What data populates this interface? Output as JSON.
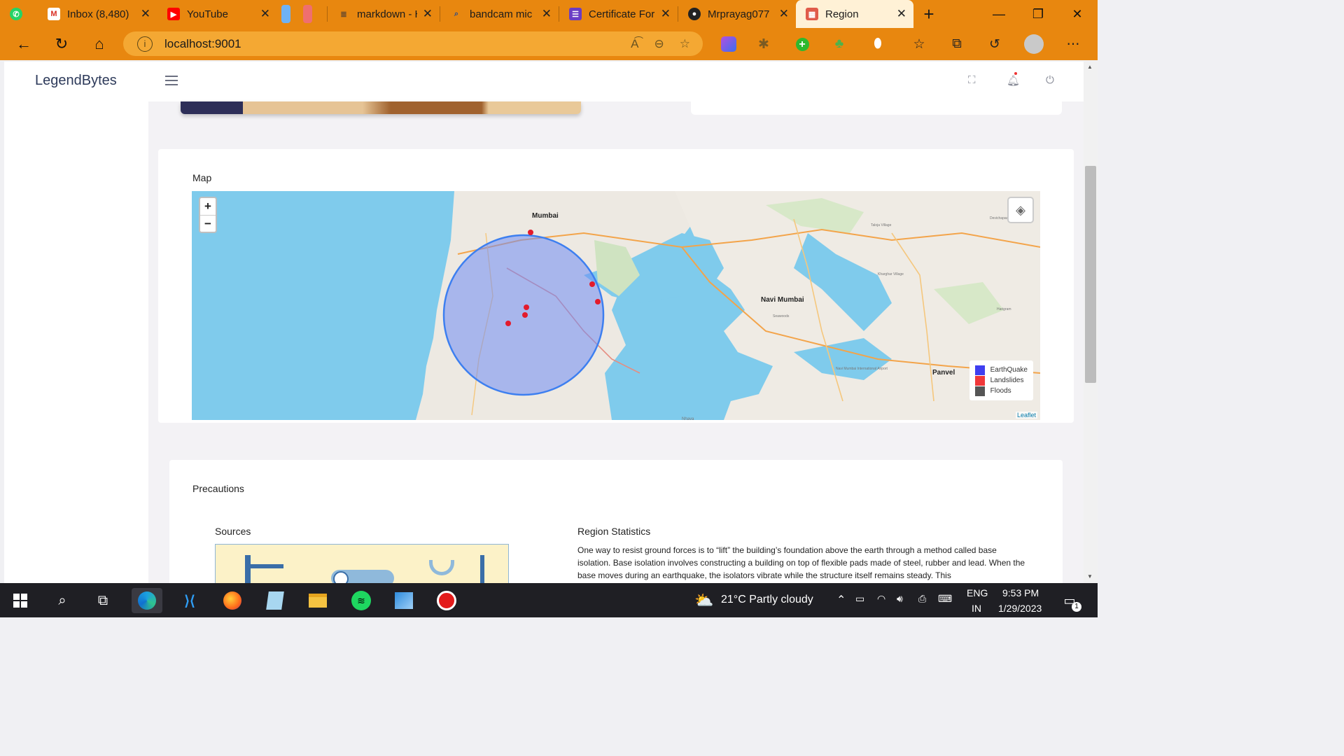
{
  "browser": {
    "tabs": [
      {
        "title": "",
        "icon": "whatsapp-icon",
        "color": "#25d366"
      },
      {
        "title": "Inbox (8,480)",
        "icon": "gmail-icon",
        "color": "#d93025"
      },
      {
        "title": "YouTube",
        "icon": "youtube-icon",
        "color": "#ff0000"
      },
      {
        "title": "",
        "icon": "pinned-blue-icon",
        "color": "#4a90e2"
      },
      {
        "title": "",
        "icon": "pinned-red-icon",
        "color": "#e35656"
      },
      {
        "title": "markdown - H",
        "icon": "stackoverflow-icon",
        "color": "#7a5c38"
      },
      {
        "title": "bandcam mic",
        "icon": "search-icon",
        "color": "#2d4f8b"
      },
      {
        "title": "Certificate For",
        "icon": "forms-icon",
        "color": "#6a3cc4"
      },
      {
        "title": "Mrprayag077",
        "icon": "github-icon",
        "color": "#222222"
      },
      {
        "title": "Region",
        "icon": "region-icon",
        "color": "#d24a3c"
      }
    ],
    "new_tab": "+",
    "url": "localhost:9001",
    "accent": "#e8870f"
  },
  "app": {
    "brand": "LegendBytes",
    "map_title": "Map",
    "precautions_title": "Precautions",
    "sources_title": "Sources",
    "stats_title": "Region Statistics",
    "stats_text": "One way to resist ground forces is to “lift” the building’s foundation above the earth through a method called base isolation. Base isolation involves constructing a building on top of flexible pads made of steel, rubber and lead. When the base moves during an earthquake, the isolators vibrate while the structure itself remains steady. This"
  },
  "map": {
    "zoom_in": "+",
    "zoom_out": "−",
    "attribution": "Leaflet",
    "labels": {
      "mumbai": "Mumbai",
      "navi_mumbai": "Navi Mumbai",
      "panvel": "Panvel"
    },
    "legend": [
      {
        "label": "EarthQuake",
        "color": "#3f3ff0"
      },
      {
        "label": "Landslides",
        "color": "#f0383a"
      },
      {
        "label": "Floods",
        "color": "#555555"
      }
    ]
  },
  "taskbar": {
    "weather": "21°C  Partly cloudy",
    "lang_top": "ENG",
    "lang_bottom": "IN",
    "time": "9:53 PM",
    "date": "1/29/2023",
    "notifications": "1"
  }
}
